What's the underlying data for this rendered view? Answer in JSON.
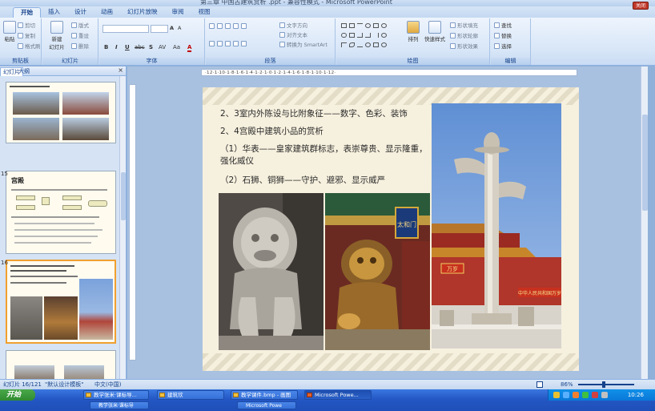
{
  "window": {
    "title": "第三章 中国古建筑赏析 .ppt - 兼容性模式 - Microsoft PowerPoint",
    "close_label": "关闭",
    "close_icon": "close-icon"
  },
  "tabs": [
    "开始",
    "插入",
    "设计",
    "动画",
    "幻灯片放映",
    "审阅",
    "视图"
  ],
  "ribbon": {
    "clipboard": {
      "label": "剪贴板",
      "paste": "粘贴",
      "cut": "剪切",
      "copy": "复制",
      "format_painter": "格式刷"
    },
    "slides": {
      "label": "幻灯片",
      "new_slide": "新建\n幻灯片",
      "layout": "版式",
      "reset": "重设",
      "delete": "删除"
    },
    "font": {
      "label": "字体",
      "bold": "B",
      "italic": "I",
      "underline": "U",
      "strike": "abc",
      "shadow": "S",
      "spacing": "AV",
      "case": "Aa",
      "color": "A",
      "grow": "A",
      "shrink": "A"
    },
    "paragraph": {
      "label": "段落",
      "text_direction": "文字方向",
      "align_text": "对齐文本",
      "smartart": "转换为 SmartArt"
    },
    "drawing": {
      "label": "绘图",
      "arrange": "排列",
      "quick_styles": "快速样式",
      "shape_fill": "形状填充",
      "shape_outline": "形状轮廓",
      "shape_effects": "形状效果"
    },
    "editing": {
      "label": "编辑",
      "find": "查找",
      "replace": "替换",
      "select": "选择"
    }
  },
  "left_panel": {
    "tab_slides": "幻灯片",
    "tab_outline": "大纲",
    "close_icon": "close-icon",
    "thumbnails": [
      {
        "number": "",
        "title": "",
        "selected": false
      },
      {
        "number": "15",
        "title": "宫殿",
        "selected": false
      },
      {
        "number": "16",
        "title": "",
        "selected": true
      },
      {
        "number": "",
        "title": "",
        "selected": false
      }
    ]
  },
  "ruler": {
    "horizontal": "·12·1·10·1·8·1·6·1·4·1·2·1·0·1·2·1·4·1·6·1·8·1·10·1·12·"
  },
  "slide": {
    "line1": "2、3室内外陈设与比附象征——数字、色彩、装饰",
    "line2": "2、4宫殿中建筑小品的赏析",
    "para1": "（1）华表——皇家建筑群标志，表崇尊贵、显示隆重，强化威仪",
    "para2": "（2）石狮、铜狮——守护、避邪、显示威严",
    "photos": [
      {
        "name": "stone-lion-photo",
        "color": "#6e6a66"
      },
      {
        "name": "bronze-lion-photo",
        "color": "#8a5a2a"
      },
      {
        "name": "huabiao-column-photo",
        "color": "#6e9ad6"
      }
    ],
    "gate_sign": "太和门",
    "banner": "中华人民共和国万岁"
  },
  "status": {
    "slide_info": "幻灯片 16/121",
    "theme": "\"默认设计模板\"",
    "language": "中文(中国)",
    "zoom": "86%"
  },
  "taskbar": {
    "start": "开始",
    "tasks": [
      {
        "label": "教学张米·课标导...",
        "active": false
      },
      {
        "label": "建筑欣",
        "active": false
      },
      {
        "label": "教学课件.bmp - 画图",
        "active": false
      },
      {
        "label": "Microsoft Powe...",
        "active": true
      }
    ],
    "tasks_row2": [
      {
        "label": "教学张米·课标导"
      },
      {
        "label": "Microsoft Powe"
      }
    ],
    "clock": "10:26"
  }
}
